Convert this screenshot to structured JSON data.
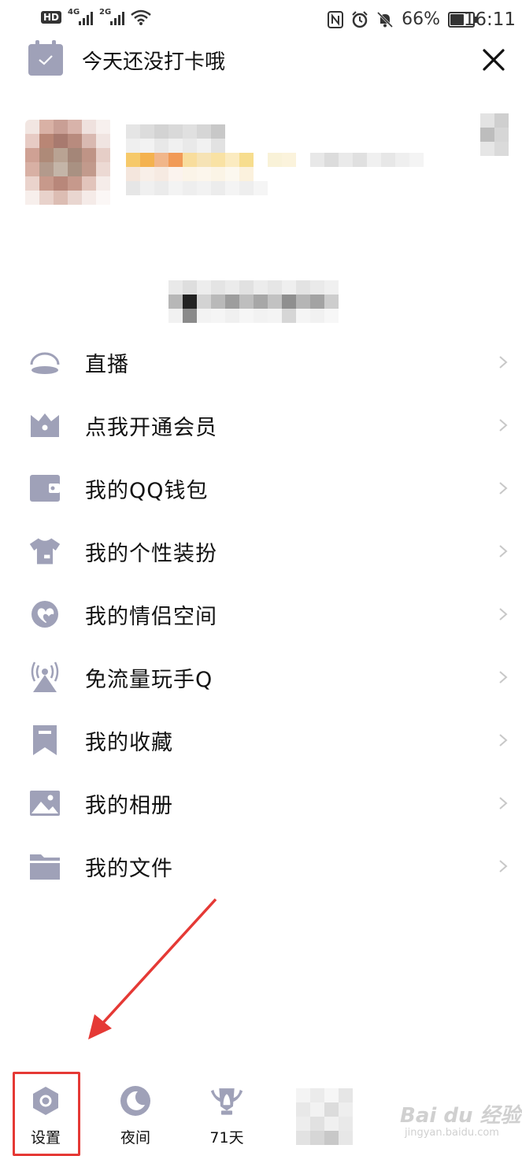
{
  "status_bar": {
    "hd_badge": "HD",
    "sim1_label": "4G",
    "sim2_label": "2G",
    "battery_percent": "66%",
    "battery_level": 0.66,
    "time": "16:11"
  },
  "header": {
    "checkin_text": "今天还没打卡哦",
    "icon": "calendar-check-icon",
    "close_icon": "close-icon"
  },
  "menu": {
    "items": [
      {
        "label": "直播",
        "icon": "live-icon"
      },
      {
        "label": "点我开通会员",
        "icon": "crown-icon"
      },
      {
        "label": "我的QQ钱包",
        "icon": "wallet-icon"
      },
      {
        "label": "我的个性装扮",
        "icon": "tshirt-icon"
      },
      {
        "label": "我的情侣空间",
        "icon": "hearts-icon"
      },
      {
        "label": "免流量玩手Q",
        "icon": "signal-tower-icon"
      },
      {
        "label": "我的收藏",
        "icon": "bookmark-icon"
      },
      {
        "label": "我的相册",
        "icon": "photo-icon"
      },
      {
        "label": "我的文件",
        "icon": "folder-icon"
      }
    ]
  },
  "bottom_bar": {
    "settings_label": "设置",
    "night_label": "夜间",
    "days_label": "71天",
    "icons": [
      "settings-icon",
      "moon-icon",
      "badge-icon"
    ]
  },
  "watermark": {
    "brand": "Bai du 经验",
    "sub": "jingyan.baidu.com"
  },
  "colors": {
    "icon_gray": "#9fa1b8",
    "highlight_red": "#e53935",
    "chevron": "#c8c8c8"
  }
}
